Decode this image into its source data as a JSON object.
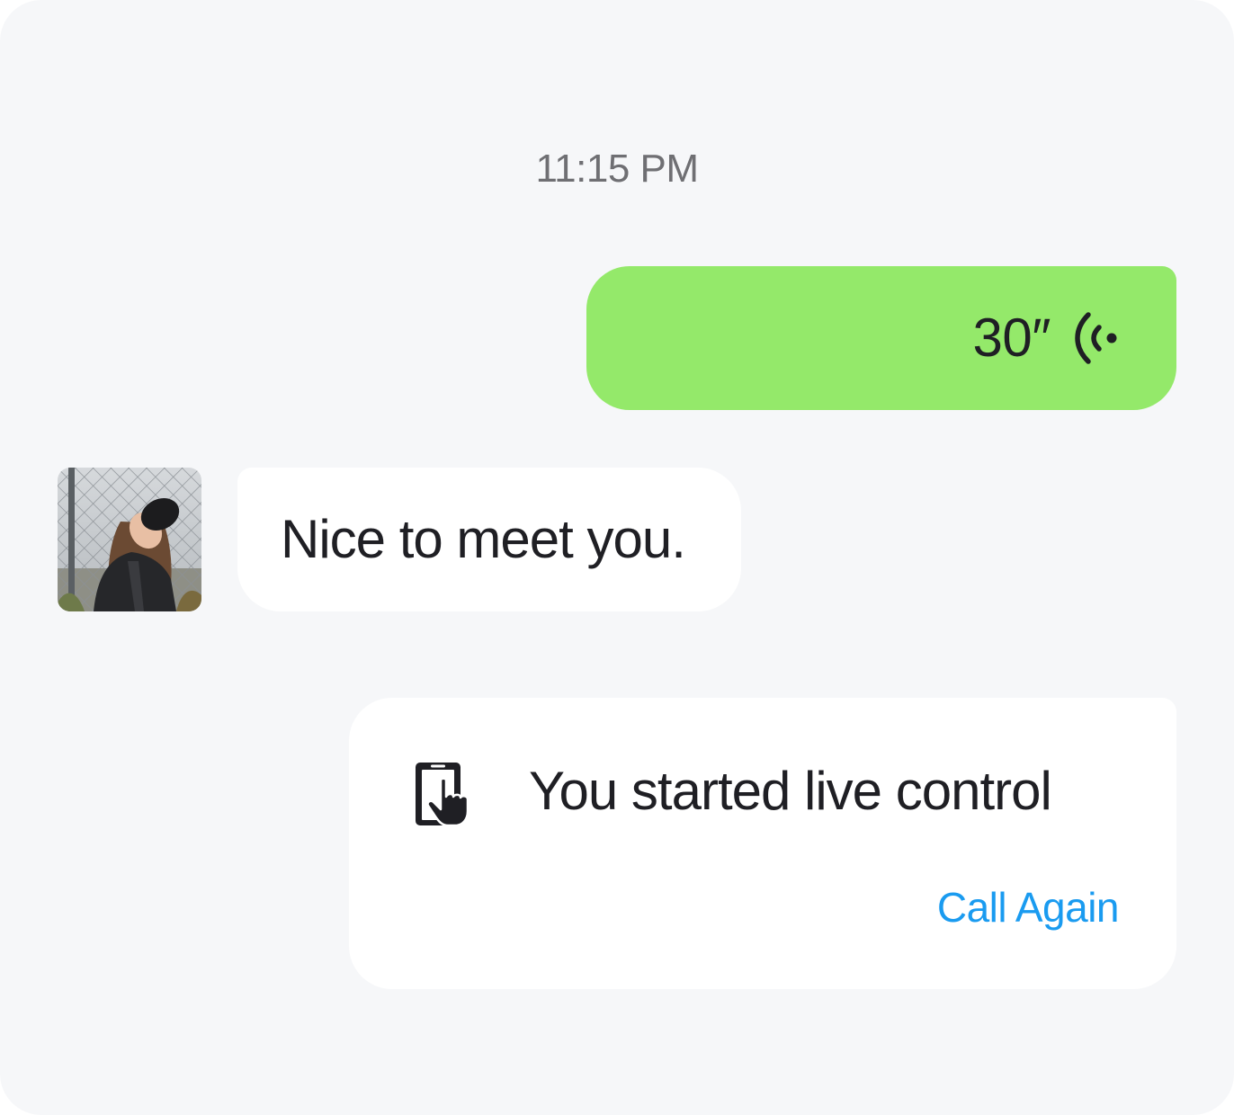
{
  "chat": {
    "timestamp": "11:15 PM",
    "outgoing_voice": {
      "duration": "30″",
      "icon": "voice-wave-icon",
      "bubble_color": "#94E96A"
    },
    "incoming_message": {
      "avatar": "user-avatar-photo",
      "text": "Nice to meet you."
    },
    "system_card": {
      "icon": "tablet-touch-icon",
      "text": "You started live control",
      "action_label": "Call Again",
      "action_color": "#1A9BF0"
    }
  },
  "colors": {
    "background": "#F6F7F9",
    "bubble_in": "#FFFFFF",
    "text_primary": "#1F1F24",
    "text_muted": "#6F6F73"
  }
}
